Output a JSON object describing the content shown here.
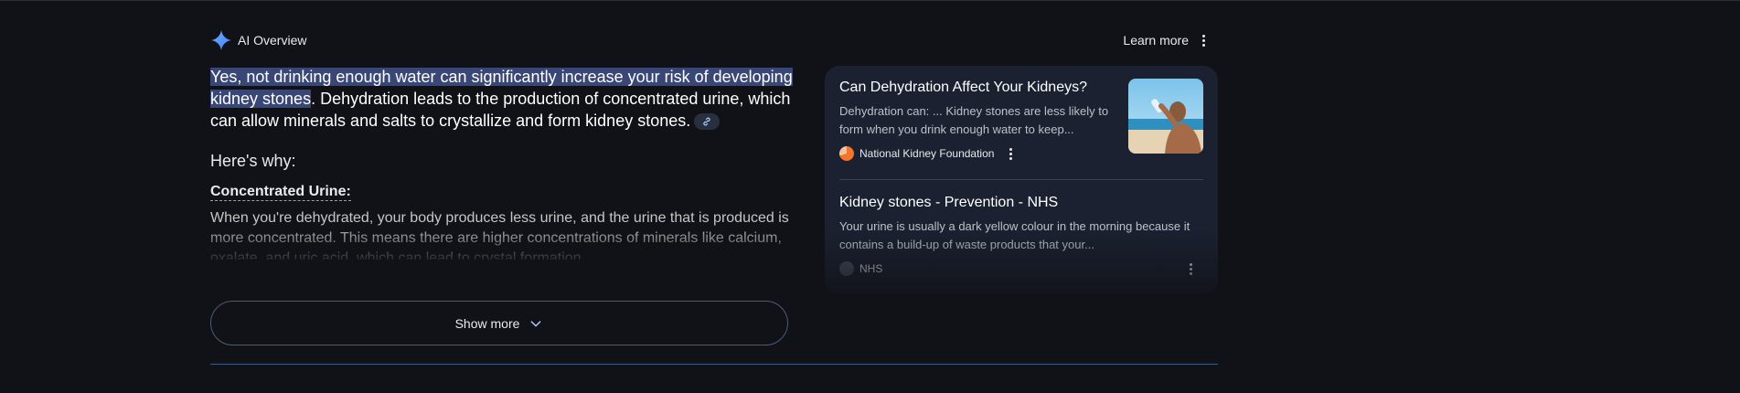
{
  "header": {
    "title": "AI Overview",
    "learn_more": "Learn more",
    "sparkle_icon": "sparkle-icon",
    "menu_icon": "more-vert-icon"
  },
  "answer": {
    "highlight": "Yes, not drinking enough water can significantly increase your risk of developing kidney stones",
    "rest": ". Dehydration leads to the production of concentrated urine, which can allow minerals and salts to crystallize and form kidney stones.",
    "link_icon": "link-icon"
  },
  "why": {
    "heading": "Here's why:",
    "subheading": "Concentrated Urine:",
    "text": "When you're dehydrated, your body produces less urine, and the urine that is produced is more concentrated. This means there are higher concentrations of minerals like calcium, oxalate, and uric acid, which can lead to crystal formation."
  },
  "show_more": {
    "label": "Show more",
    "icon": "chevron-down-icon"
  },
  "sources": [
    {
      "title": "Can Dehydration Affect Your Kidneys?",
      "snippet": "Dehydration can: ... Kidney stones are less likely to form when you drink enough water to keep...",
      "site": "National Kidney Foundation",
      "favicon_color": "#f3762d",
      "has_thumbnail": true
    },
    {
      "title": "Kidney stones - Prevention - NHS",
      "snippet": "Your urine is usually a dark yellow colour in the morning because it contains a build-up of waste products that your...",
      "site": "NHS",
      "favicon_color": "#4b5463",
      "has_thumbnail": false
    }
  ],
  "colors": {
    "background": "#101218",
    "highlight": "#394776",
    "panel": "#1b2130",
    "accent_border": "#4a5c78"
  }
}
